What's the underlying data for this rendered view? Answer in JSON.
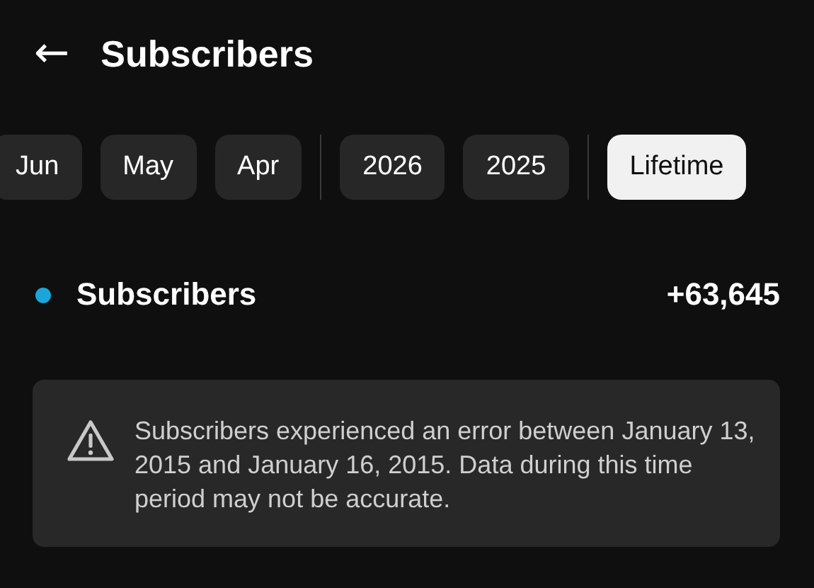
{
  "header": {
    "back_icon": "←",
    "title": "Subscribers"
  },
  "chip_groups": [
    {
      "chips": [
        {
          "label": "Jun",
          "selected": false
        },
        {
          "label": "May",
          "selected": false
        },
        {
          "label": "Apr",
          "selected": false
        }
      ]
    },
    {
      "chips": [
        {
          "label": "2026",
          "selected": false
        },
        {
          "label": "2025",
          "selected": false
        }
      ]
    },
    {
      "chips": [
        {
          "label": "Lifetime",
          "selected": true
        }
      ]
    }
  ],
  "metric": {
    "label": "Subscribers",
    "color": "#1aa6d9",
    "value": "+63,645"
  },
  "notice": {
    "text": "Subscribers experienced an error between January 13, 2015 and January 16, 2015. Data during this time period may not be accurate."
  }
}
